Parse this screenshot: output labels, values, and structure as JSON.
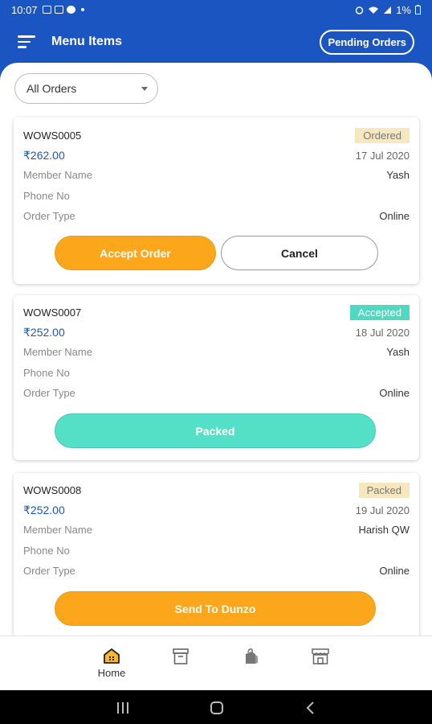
{
  "status_bar": {
    "time": "10:07",
    "battery": "1%"
  },
  "app_bar": {
    "title": "Menu Items",
    "pending_button": "Pending Orders"
  },
  "filter": {
    "selected": "All Orders"
  },
  "labels": {
    "member_name": "Member Name",
    "phone_no": "Phone No",
    "order_type": "Order Type"
  },
  "orders": [
    {
      "id": "WOWS0005",
      "status": "Ordered",
      "price": "₹262.00",
      "date": "17 Jul 2020",
      "member_name": "Yash",
      "phone": "",
      "order_type": "Online",
      "primary_action": "Accept Order",
      "secondary_action": "Cancel"
    },
    {
      "id": "WOWS0007",
      "status": "Accepted",
      "price": "₹252.00",
      "date": "18 Jul 2020",
      "member_name": "Yash",
      "phone": "",
      "order_type": "Online",
      "primary_action": "Packed"
    },
    {
      "id": "WOWS0008",
      "status": "Packed",
      "price": "₹252.00",
      "date": "19 Jul 2020",
      "member_name": "Harish QW",
      "phone": "",
      "order_type": "Online",
      "primary_action": "Send To Dunzo"
    }
  ],
  "bottom_nav": [
    {
      "label": "Home",
      "icon": "home-icon",
      "active": true
    },
    {
      "label": "",
      "icon": "archive-box-icon"
    },
    {
      "label": "",
      "icon": "shopping-bag-icon"
    },
    {
      "label": "",
      "icon": "store-icon"
    }
  ],
  "colors": {
    "primary": "#1b55c2",
    "orange": "#fba61b",
    "teal": "#53e0c6",
    "badge_beige": "#f7e7bf"
  }
}
